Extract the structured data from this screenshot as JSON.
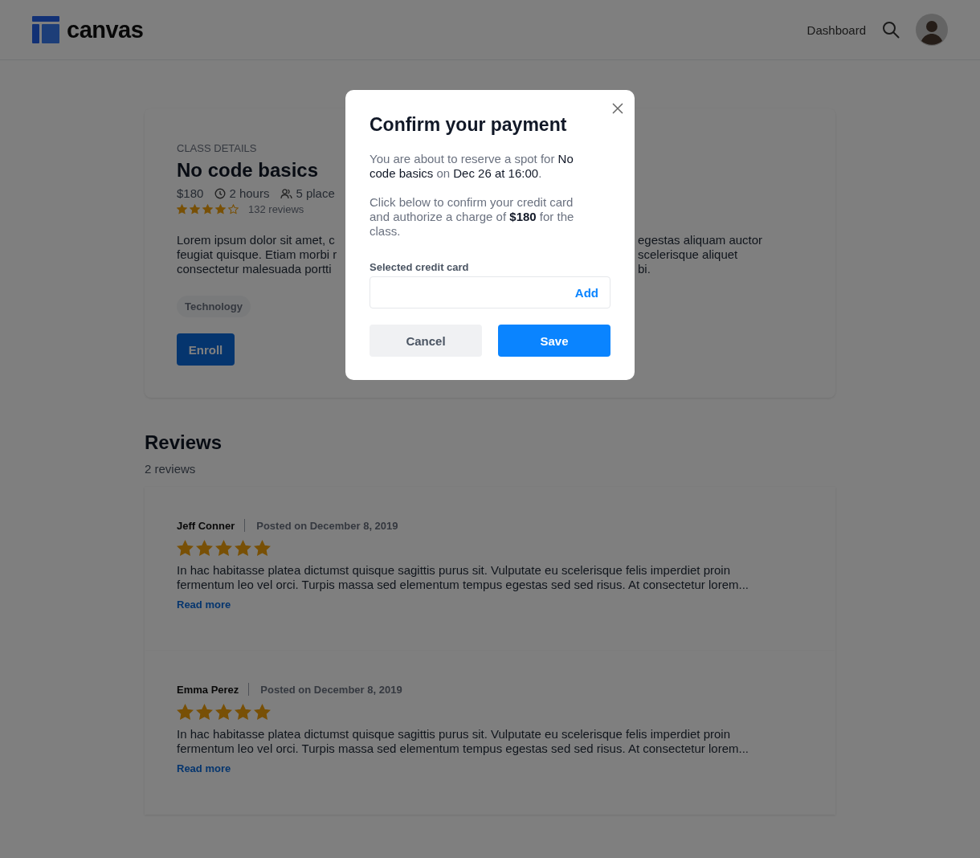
{
  "header": {
    "logo": "canvas",
    "nav": "Dashboard"
  },
  "class_card": {
    "eyebrow": "CLASS DETAILS",
    "title": "No code basics",
    "price": "$180",
    "duration": "2 hours",
    "places": "5 place",
    "stars": 4,
    "review_count": "132 reviews",
    "description_left": [
      "Lorem ipsum dolor sit amet, c",
      "feugiat quisque. Etiam morbi r",
      "consectetur malesuada portti"
    ],
    "description_right": [
      "egestas aliquam auctor",
      "scelerisque aliquet",
      "bi."
    ],
    "tag": "Technology",
    "button": "Enroll"
  },
  "reviews": {
    "title": "Reviews",
    "count": "2 reviews",
    "items": [
      {
        "author": "Jeff Conner",
        "date": "Posted on December 8, 2019",
        "stars": 5,
        "text": "In hac habitasse platea dictumst quisque sagittis purus sit. Vulputate eu scelerisque felis imperdiet proin fermentum leo vel orci. Turpis massa sed elementum tempus egestas sed sed risus. At consectetur lorem...",
        "link": "Read more"
      },
      {
        "author": "Emma Perez",
        "date": "Posted on December 8, 2019",
        "stars": 5,
        "text": "In hac habitasse platea dictumst quisque sagittis purus sit. Vulputate eu scelerisque felis imperdiet proin fermentum leo vel orci. Turpis massa sed elementum tempus egestas sed sed risus. At consectetur lorem...",
        "link": "Read more"
      }
    ]
  },
  "modal": {
    "title": "Confirm your payment",
    "paragraphs": [
      [
        {
          "kind": "muted",
          "text": "You are about to reserve a spot for "
        },
        {
          "kind": "dark",
          "text": "No code basics"
        },
        {
          "kind": "muted",
          "text": " on "
        },
        {
          "kind": "dark",
          "text": "Dec 26 at 16:00"
        },
        {
          "kind": "muted",
          "text": "."
        }
      ],
      [
        {
          "kind": "muted",
          "text": "Click below to confirm your credit card and authorize a charge of "
        },
        {
          "kind": "bold",
          "text": "$180"
        },
        {
          "kind": "muted",
          "text": " for the class."
        }
      ]
    ],
    "field_label": "Selected credit card",
    "field_action": "Add",
    "cancel": "Cancel",
    "save": "Save"
  }
}
